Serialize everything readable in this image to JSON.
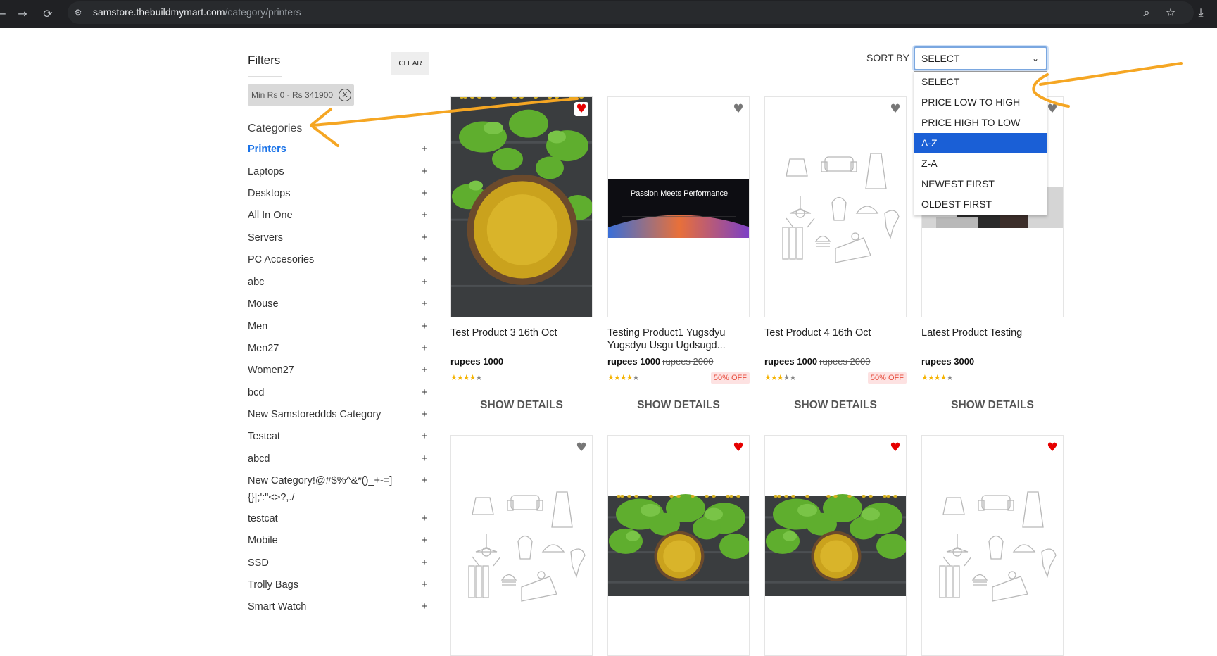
{
  "browser": {
    "url_host": "samstore.thebuildmymart.com",
    "url_path": "/category/printers"
  },
  "filters": {
    "title": "Filters",
    "clear_label": "CLEAR",
    "price_chip": "Min Rs 0 - Rs 341900",
    "chip_close": "X"
  },
  "categories": {
    "title": "Categories",
    "items": [
      {
        "label": "Printers",
        "active": true
      },
      {
        "label": "Laptops"
      },
      {
        "label": "Desktops"
      },
      {
        "label": "All In One"
      },
      {
        "label": "Servers"
      },
      {
        "label": "PC Accesories"
      },
      {
        "label": "abc"
      },
      {
        "label": "Mouse"
      },
      {
        "label": "Men"
      },
      {
        "label": "Men27"
      },
      {
        "label": "Women27"
      },
      {
        "label": "bcd"
      },
      {
        "label": "New Samstoreddds Category"
      },
      {
        "label": "Testcat"
      },
      {
        "label": "abcd"
      },
      {
        "label": "New Category!@#$%^&*()_+-=]{}|;':\"<>?,./"
      },
      {
        "label": "testcat"
      },
      {
        "label": "Mobile"
      },
      {
        "label": "SSD"
      },
      {
        "label": "Trolly Bags"
      },
      {
        "label": "Smart Watch"
      }
    ],
    "expand_symbol": "+"
  },
  "sort": {
    "label": "SORT BY",
    "selected": "SELECT",
    "options": [
      "SELECT",
      "PRICE LOW TO HIGH",
      "PRICE HIGH TO LOW",
      "A-Z",
      "Z-A",
      "NEWEST FIRST",
      "OLDEST FIRST"
    ],
    "highlighted": "A-Z"
  },
  "products": [
    {
      "title": "Test Product 3 16th Oct",
      "price": "rupees 1000",
      "old_price": "",
      "discount": "",
      "rating": 3.5,
      "wishlisted": true,
      "image": "fenugreek-seeds",
      "button": "SHOW DETAILS"
    },
    {
      "title": "Testing Product1 Yugsdyu Yugsdyu Usgu Ugdsugd...",
      "price": "rupees 1000",
      "old_price": "rupees 2000",
      "discount": "50% OFF",
      "rating": 3.5,
      "wishlisted": false,
      "image": "laptop-banner",
      "banner_text": "Passion Meets Performance",
      "button": "SHOW DETAILS"
    },
    {
      "title": "Test Product 4 16th Oct",
      "price": "rupees 1000",
      "old_price": "rupees 2000",
      "discount": "50% OFF",
      "rating": 3,
      "wishlisted": false,
      "image": "placeholder-sketch",
      "button": "SHOW DETAILS"
    },
    {
      "title": "Latest Product Testing",
      "price": "rupees 3000",
      "old_price": "",
      "discount": "",
      "rating": 3.5,
      "wishlisted": false,
      "image": "photo",
      "button": "SHOW DETAILS"
    },
    {
      "wishlisted": false,
      "image": "placeholder-sketch"
    },
    {
      "wishlisted": true,
      "image": "fenugreek-seeds"
    },
    {
      "wishlisted": true,
      "image": "fenugreek-seeds"
    },
    {
      "wishlisted": true,
      "image": "placeholder-sketch"
    }
  ],
  "colors": {
    "accent": "#1a73e8",
    "annotation": "#f5a623",
    "heart_on": "#e60000",
    "star": "#f5b301"
  }
}
